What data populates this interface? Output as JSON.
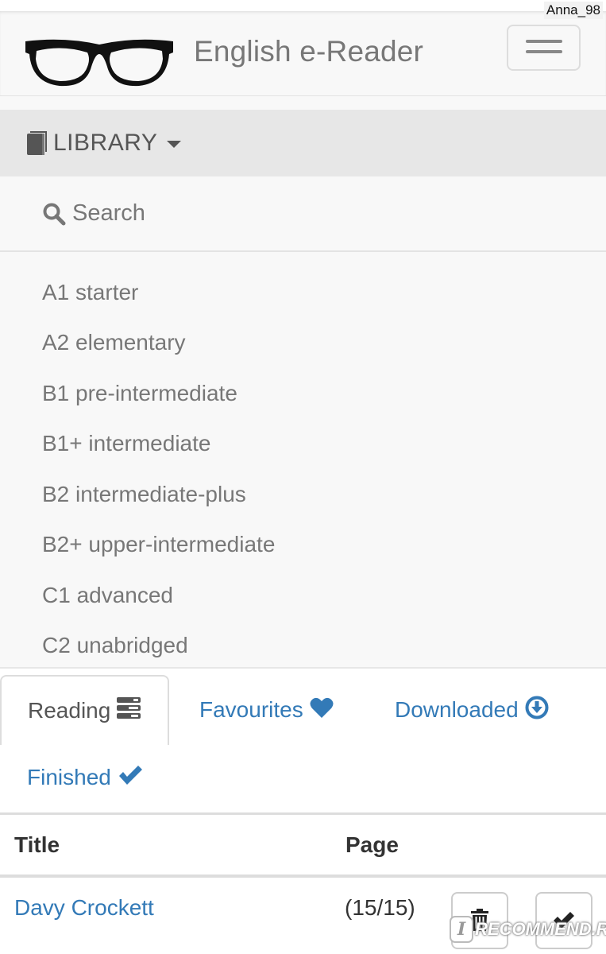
{
  "watermark_user": "Anna_98",
  "header": {
    "brand_title": "English e-Reader",
    "logo_icon": "glasses-icon",
    "menu_toggle_icon": "hamburger-icon"
  },
  "menu": {
    "library": {
      "label": "LIBRARY",
      "icon": "book-icon",
      "caret_icon": "caret-down-icon"
    },
    "search": {
      "label": "Search",
      "icon": "search-icon"
    },
    "levels": [
      "A1 starter",
      "A2 elementary",
      "B1 pre-intermediate",
      "B1+ intermediate",
      "B2 intermediate-plus",
      "B2+ upper-intermediate",
      "C1 advanced",
      "C2 unabridged"
    ]
  },
  "tabs": [
    {
      "label": "Reading",
      "icon": "tasks-icon",
      "active": true
    },
    {
      "label": "Favourites",
      "icon": "heart-icon",
      "active": false
    },
    {
      "label": "Downloaded",
      "icon": "download-circle-icon",
      "active": false
    },
    {
      "label": "Finished",
      "icon": "checkmark-icon",
      "active": false
    }
  ],
  "table": {
    "columns": [
      "Title",
      "Page"
    ],
    "rows": [
      {
        "title": "Davy Crockett",
        "page": "(15/15)",
        "actions": [
          "trash-icon",
          "checkmark-icon"
        ]
      }
    ]
  },
  "site_watermark": {
    "badge": "I",
    "text": "RECOMMEND.RU"
  },
  "colors": {
    "link": "#337ab7",
    "muted_text": "#777777",
    "navbar_bg": "#f8f8f8",
    "dropdown_active_bg": "#e7e7e7"
  }
}
